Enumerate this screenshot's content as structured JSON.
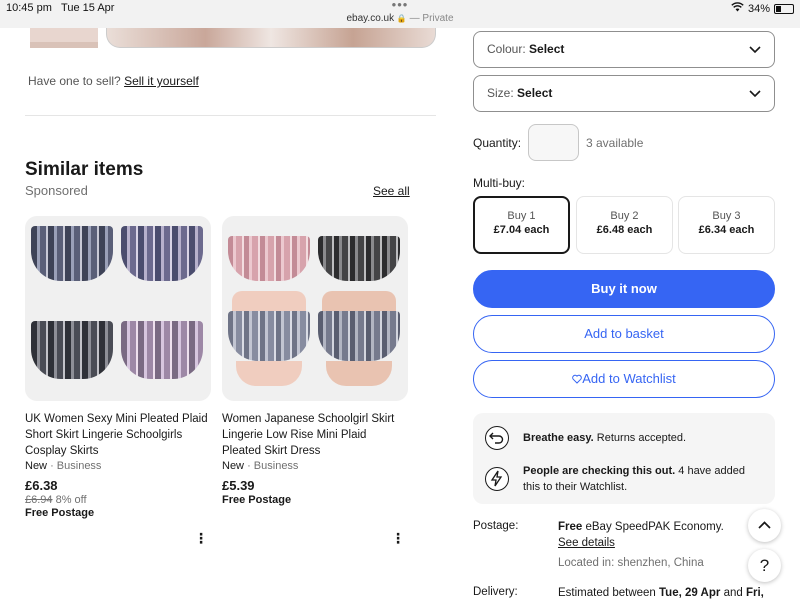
{
  "status": {
    "time": "10:45 pm",
    "date": "Tue 15 Apr",
    "url": "ebay.co.uk",
    "private": "— Private",
    "battery": "34%",
    "battery_level": 0.34
  },
  "sell": {
    "prompt": "Have one to sell?",
    "link": "Sell it yourself"
  },
  "similar": {
    "title": "Similar items",
    "subtitle": "Sponsored",
    "see_all": "See all",
    "items": [
      {
        "title": "UK Women Sexy Mini Pleated Plaid Short Skirt Lingerie Schoolgirls Cosplay Skirts",
        "condition": "New",
        "seller": "· Business",
        "price": "£6.38",
        "was": "£6.94",
        "off": "8% off",
        "postage": "Free Postage"
      },
      {
        "title": "Women Japanese Schoolgirl Skirt Lingerie Low Rise Mini Plaid Pleated Skirt Dress",
        "condition": "New",
        "seller": "· Business",
        "price": "£5.39",
        "postage": "Free Postage"
      }
    ]
  },
  "options": {
    "colour_label": "Colour:",
    "colour_value": "Select",
    "size_label": "Size:",
    "size_value": "Select"
  },
  "quantity": {
    "label": "Quantity:",
    "value": "",
    "available": "3 available"
  },
  "multibuy": {
    "label": "Multi-buy:",
    "options": [
      {
        "label": "Buy 1",
        "price": "£7.04 each"
      },
      {
        "label": "Buy 2",
        "price": "£6.48 each"
      },
      {
        "label": "Buy 3",
        "price": "£6.34 each"
      }
    ]
  },
  "actions": {
    "buy_now": "Buy it now",
    "basket": "Add to basket",
    "watchlist": "Add to Watchlist"
  },
  "info": {
    "returns_bold": "Breathe easy.",
    "returns_text": " Returns accepted.",
    "watch_bold": "People are checking this out.",
    "watch_text": " 4 have added",
    "watch_text2": "this to their Watchlist."
  },
  "postage": {
    "label": "Postage:",
    "free": "Free",
    "service": " eBay SpeedPAK Economy.",
    "details": "See details",
    "location": "Located in: shenzhen, China"
  },
  "delivery": {
    "label": "Delivery:",
    "text": "Estimated between ",
    "dates": "Tue, 29 Apr",
    "and": " and ",
    "end": "Fri,"
  },
  "fab": {
    "help": "?"
  }
}
